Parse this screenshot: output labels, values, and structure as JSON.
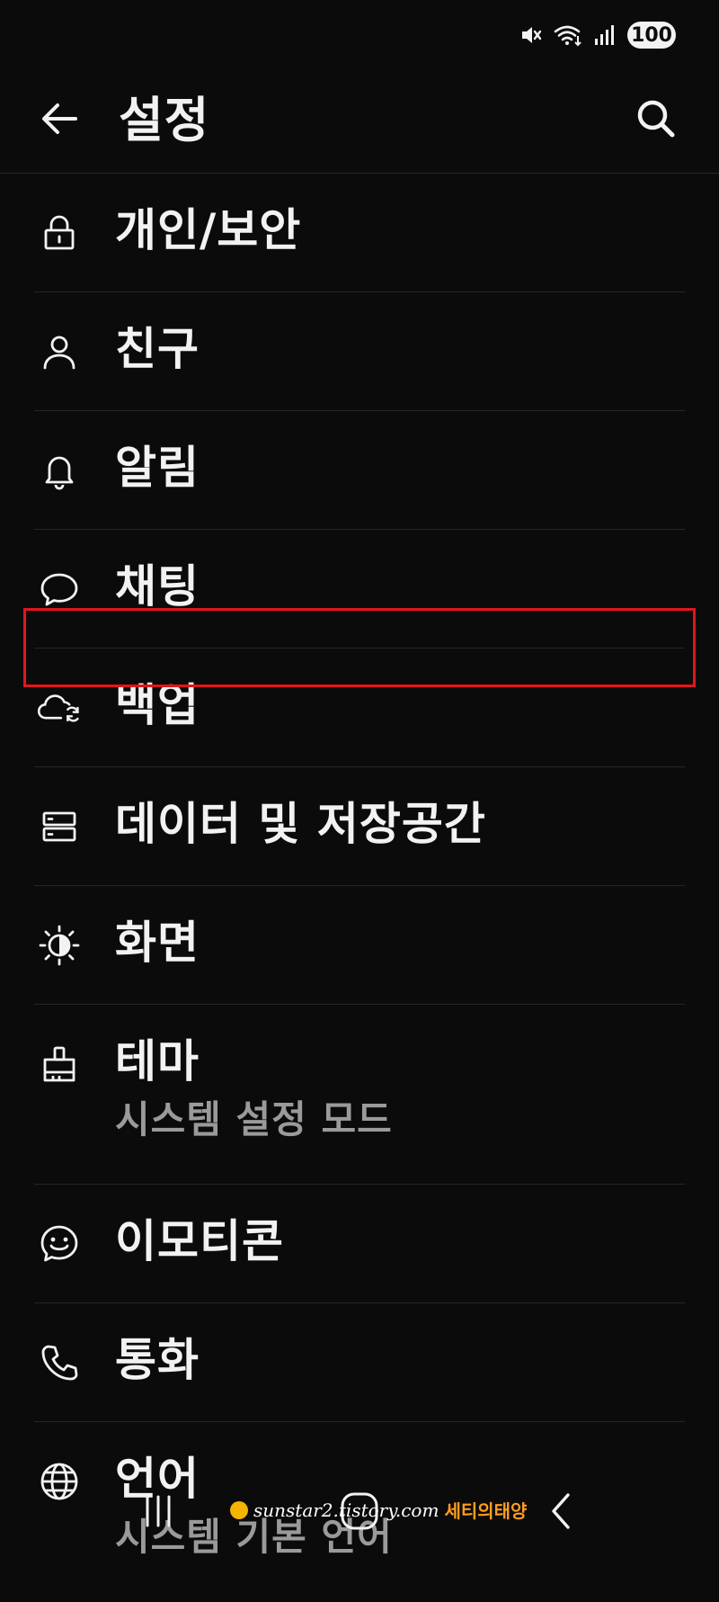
{
  "status_bar": {
    "battery": "100",
    "icons": [
      "mute-icon",
      "wifi-icon",
      "signal-icon"
    ]
  },
  "header": {
    "title": "설정",
    "back_icon": "arrow-left-icon",
    "search_icon": "search-icon"
  },
  "menu": [
    {
      "id": "privacy",
      "label": "개인/보안",
      "icon": "lock-icon"
    },
    {
      "id": "friends",
      "label": "친구",
      "icon": "person-icon"
    },
    {
      "id": "notifications",
      "label": "알림",
      "icon": "bell-icon"
    },
    {
      "id": "chat",
      "label": "채팅",
      "icon": "chat-bubble-icon"
    },
    {
      "id": "backup",
      "label": "백업",
      "icon": "cloud-sync-icon"
    },
    {
      "id": "storage",
      "label": "데이터 및 저장공간",
      "icon": "storage-icon",
      "highlighted": true
    },
    {
      "id": "display",
      "label": "화면",
      "icon": "brightness-icon"
    },
    {
      "id": "theme",
      "label": "테마",
      "sublabel": "시스템 설정 모드",
      "icon": "paint-brush-icon"
    },
    {
      "id": "emoticons",
      "label": "이모티콘",
      "icon": "smiley-icon"
    },
    {
      "id": "call",
      "label": "통화",
      "icon": "phone-icon"
    },
    {
      "id": "language",
      "label": "언어",
      "sublabel": "시스템 기본 언어",
      "icon": "globe-icon"
    }
  ],
  "highlight_color": "#e0161c",
  "watermark": {
    "url": "sunstar2.tistory.com",
    "brand": "세티의태양"
  },
  "nav_bar": {
    "icons": [
      "recent-apps-icon",
      "home-icon",
      "back-icon"
    ]
  }
}
